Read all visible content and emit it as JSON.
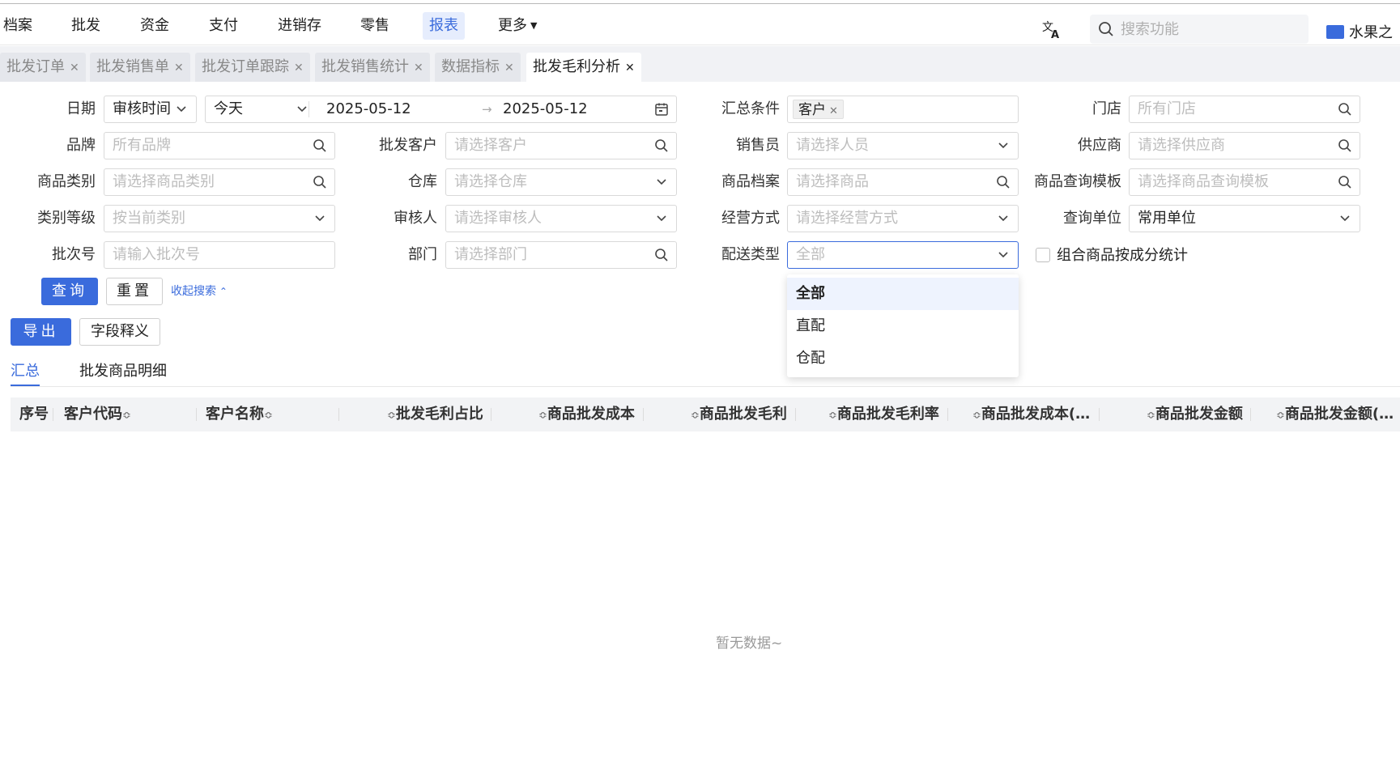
{
  "nav": {
    "items": [
      "档案",
      "批发",
      "资金",
      "支付",
      "进销存",
      "零售",
      "报表",
      "更多"
    ],
    "active": "报表",
    "search_placeholder": "搜索功能",
    "store_name": "水果之"
  },
  "tabs": [
    {
      "label": "批发订单",
      "active": false
    },
    {
      "label": "批发销售单",
      "active": false
    },
    {
      "label": "批发订单跟踪",
      "active": false
    },
    {
      "label": "批发销售统计",
      "active": false
    },
    {
      "label": "数据指标",
      "active": false
    },
    {
      "label": "批发毛利分析",
      "active": true
    }
  ],
  "filters": {
    "date": {
      "label": "日期",
      "type_value": "审核时间",
      "range_value": "今天",
      "start": "2025-05-12",
      "end": "2025-05-12"
    },
    "summary": {
      "label": "汇总条件",
      "tag": "客户"
    },
    "store": {
      "label": "门店",
      "placeholder": "所有门店"
    },
    "brand": {
      "label": "品牌",
      "placeholder": "所有品牌"
    },
    "customer": {
      "label": "批发客户",
      "placeholder": "请选择客户"
    },
    "salesperson": {
      "label": "销售员",
      "placeholder": "请选择人员"
    },
    "supplier": {
      "label": "供应商",
      "placeholder": "请选择供应商"
    },
    "category": {
      "label": "商品类别",
      "placeholder": "请选择商品类别"
    },
    "warehouse": {
      "label": "仓库",
      "placeholder": "请选择仓库"
    },
    "product": {
      "label": "商品档案",
      "placeholder": "请选择商品"
    },
    "template": {
      "label": "商品查询模板",
      "placeholder": "请选择商品查询模板"
    },
    "category_level": {
      "label": "类别等级",
      "placeholder": "按当前类别"
    },
    "auditor": {
      "label": "审核人",
      "placeholder": "请选择审核人"
    },
    "business_mode": {
      "label": "经营方式",
      "placeholder": "请选择经营方式"
    },
    "query_unit": {
      "label": "查询单位",
      "value": "常用单位"
    },
    "batch": {
      "label": "批次号",
      "placeholder": "请输入批次号"
    },
    "department": {
      "label": "部门",
      "placeholder": "请选择部门"
    },
    "delivery": {
      "label": "配送类型",
      "placeholder": "全部"
    },
    "combo_checkbox": {
      "label": "组合商品按成分统计",
      "checked": false
    }
  },
  "buttons": {
    "query": "查询",
    "reset": "重置",
    "collapse": "收起搜索",
    "export": "导出",
    "field_def": "字段释义"
  },
  "dropdown": {
    "options": [
      "全部",
      "直配",
      "仓配"
    ],
    "selected": "全部"
  },
  "subtabs": [
    {
      "label": "汇总",
      "active": true
    },
    {
      "label": "批发商品明细",
      "active": false
    }
  ],
  "table": {
    "columns": [
      "序号",
      "客户代码",
      "客户名称",
      "批发毛利占比",
      "商品批发成本",
      "商品批发毛利",
      "商品批发毛利率",
      "商品批发成本(…",
      "商品批发金额",
      "商品批发金额(…"
    ],
    "empty_text": "暂无数据~"
  },
  "colors": {
    "accent": "#3a6bdc",
    "header_bg": "#f2f3f5",
    "tab_bg": "#f1f2f5"
  }
}
